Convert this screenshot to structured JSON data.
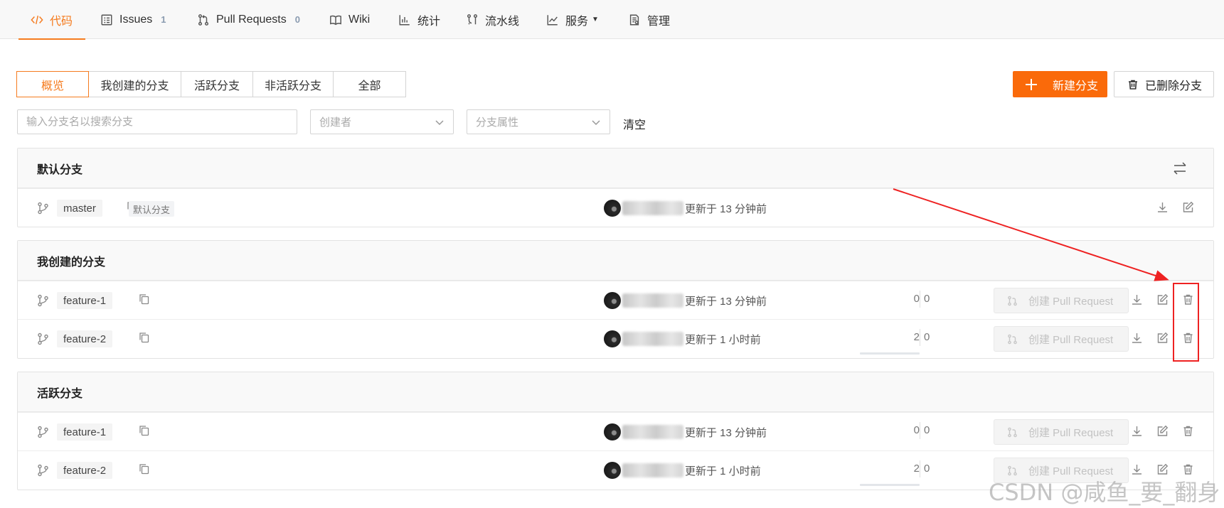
{
  "nav": {
    "tabs": [
      {
        "label": "代码",
        "icon": "code-icon",
        "active": true
      },
      {
        "label": "Issues",
        "count": "1",
        "icon": "issues-icon"
      },
      {
        "label": "Pull Requests",
        "count": "0",
        "icon": "pull-request-icon"
      },
      {
        "label": "Wiki",
        "icon": "book-icon"
      },
      {
        "label": "统计",
        "icon": "bar-chart-icon"
      },
      {
        "label": "流水线",
        "icon": "pipeline-icon"
      },
      {
        "label": "服务",
        "icon": "line-chart-icon",
        "dropdown": true
      },
      {
        "label": "管理",
        "icon": "settings-doc-icon"
      }
    ]
  },
  "filters": {
    "tabs": [
      "概览",
      "我创建的分支",
      "活跃分支",
      "非活跃分支",
      "全部"
    ],
    "active_index": 0,
    "new_branch_label": "新建分支",
    "deleted_branches_label": "已删除分支",
    "search_placeholder": "输入分支名以搜索分支",
    "creator_placeholder": "创建者",
    "attr_placeholder": "分支属性",
    "clear_label": "清空"
  },
  "sections": [
    {
      "title": "默认分支",
      "rows": [
        {
          "branch": "master",
          "tag": "默认分支",
          "updated": "更新于 13 分钟前"
        }
      ]
    },
    {
      "title": "我创建的分支",
      "rows": [
        {
          "branch": "feature-1",
          "updated": "更新于 13 分钟前",
          "ahead": "0",
          "behind": "0",
          "pr_label": "创建 Pull Request"
        },
        {
          "branch": "feature-2",
          "updated": "更新于 1 小时前",
          "ahead": "2",
          "behind": "0",
          "pr_label": "创建 Pull Request"
        }
      ]
    },
    {
      "title": "活跃分支",
      "rows": [
        {
          "branch": "feature-1",
          "updated": "更新于 13 分钟前",
          "ahead": "0",
          "behind": "0",
          "pr_label": "创建 Pull Request"
        },
        {
          "branch": "feature-2",
          "updated": "更新于 1 小时前",
          "ahead": "2",
          "behind": "0",
          "pr_label": "创建 Pull Request"
        }
      ]
    }
  ],
  "colors": {
    "accent": "#fa6a0a",
    "annotation": "#ee2222"
  },
  "watermark": "CSDN @咸鱼_要_翻身"
}
